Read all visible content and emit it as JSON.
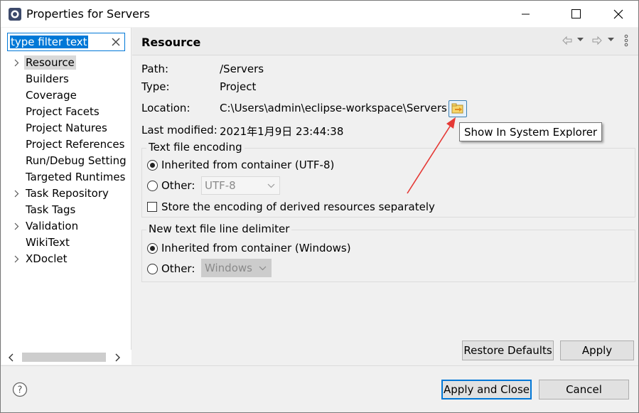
{
  "window": {
    "title": "Properties for Servers"
  },
  "filter": {
    "text": "type filter text"
  },
  "tree": {
    "items": [
      {
        "label": "Resource",
        "expandable": true,
        "selected": true
      },
      {
        "label": "Builders",
        "expandable": false,
        "selected": false
      },
      {
        "label": "Coverage",
        "expandable": false,
        "selected": false
      },
      {
        "label": "Project Facets",
        "expandable": false,
        "selected": false
      },
      {
        "label": "Project Natures",
        "expandable": false,
        "selected": false
      },
      {
        "label": "Project References",
        "expandable": false,
        "selected": false
      },
      {
        "label": "Run/Debug Setting",
        "expandable": false,
        "selected": false
      },
      {
        "label": "Targeted Runtimes",
        "expandable": false,
        "selected": false
      },
      {
        "label": "Task Repository",
        "expandable": true,
        "selected": false
      },
      {
        "label": "Task Tags",
        "expandable": false,
        "selected": false
      },
      {
        "label": "Validation",
        "expandable": true,
        "selected": false
      },
      {
        "label": "WikiText",
        "expandable": false,
        "selected": false
      },
      {
        "label": "XDoclet",
        "expandable": true,
        "selected": false
      }
    ]
  },
  "page": {
    "title": "Resource",
    "path_label": "Path:",
    "path_value": "/Servers",
    "type_label": "Type:",
    "type_value": "Project",
    "location_label": "Location:",
    "location_value": "C:\\Users\\admin\\eclipse-workspace\\Servers",
    "modified_label": "Last modified:",
    "modified_value": "2021年1月9日 23:44:38",
    "tooltip": "Show In System Explorer"
  },
  "encoding": {
    "group_title": "Text file encoding",
    "inherited_label": "Inherited from container (UTF-8)",
    "other_label": "Other:",
    "other_value": "UTF-8",
    "store_label": "Store the encoding of derived resources separately"
  },
  "delimiter": {
    "group_title": "New text file line delimiter",
    "inherited_label": "Inherited from container (Windows)",
    "other_label": "Other:",
    "other_value": "Windows"
  },
  "buttons": {
    "restore_defaults": "Restore Defaults",
    "apply": "Apply",
    "apply_and_close": "Apply and Close",
    "cancel": "Cancel"
  },
  "colors": {
    "accent": "#0078d7",
    "annotation_arrow": "#e53935",
    "selection_bg": "#d9d9d9"
  }
}
